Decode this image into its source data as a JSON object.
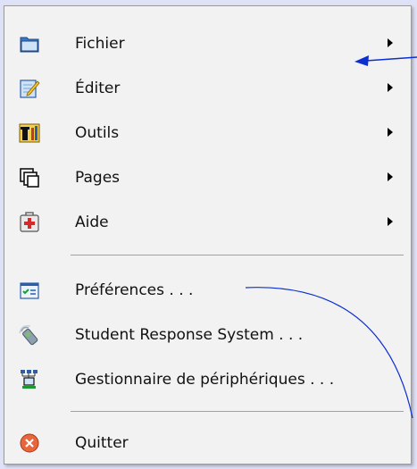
{
  "menu": {
    "items": [
      {
        "label": "Fichier",
        "icon": "folder-icon",
        "submenu": true
      },
      {
        "label": "Éditer",
        "icon": "edit-icon",
        "submenu": true
      },
      {
        "label": "Outils",
        "icon": "tools-icon",
        "submenu": true
      },
      {
        "label": "Pages",
        "icon": "pages-icon",
        "submenu": true
      },
      {
        "label": "Aide",
        "icon": "help-icon",
        "submenu": true
      },
      {
        "label": "Préférences . . .",
        "icon": "preferences-icon",
        "submenu": false
      },
      {
        "label": "Student Response System . . .",
        "icon": "student-response-icon",
        "submenu": false
      },
      {
        "label": "Gestionnaire de périphériques . . .",
        "icon": "device-manager-icon",
        "submenu": false
      },
      {
        "label": "Quitter",
        "icon": "quit-icon",
        "submenu": false
      }
    ]
  },
  "colors": {
    "background": "#dfe1f7",
    "menu": "#f2f2f2",
    "annotation": "#0b2fd1"
  }
}
